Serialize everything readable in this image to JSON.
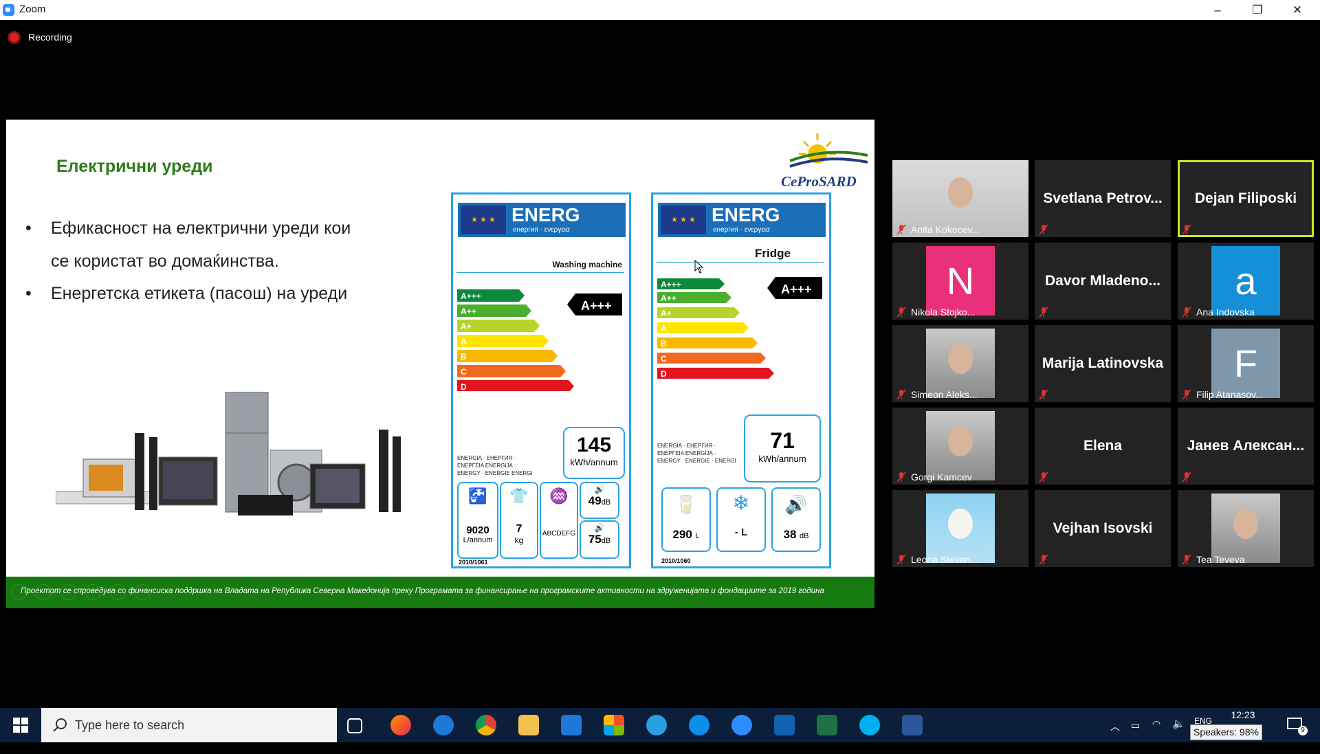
{
  "window": {
    "app_title": "Zoom",
    "minimize": "–",
    "maximize": "❐",
    "close": "✕"
  },
  "recording": {
    "label": "Recording"
  },
  "slide": {
    "title": "Електрични уреди",
    "bullets": [
      "Ефикасност на електрични уреди кои",
      "се користат во домаќинства.",
      "Енергетска етикета (пасош) на уреди"
    ],
    "logo": "CeProSARD",
    "washing_label": {
      "header": "ENERG",
      "subheader": "енергия · ενεργεια",
      "lang_tags": [
        "Y",
        "IJA",
        "IE",
        "IA"
      ],
      "device": "Washing machine",
      "classes": [
        "A+++",
        "A++",
        "A+",
        "A",
        "B",
        "C",
        "D"
      ],
      "rating": "A+++",
      "energy_text": "ENERGIA · ЕНЕРГИЯ · ΕΝΕΡΓΕΙΑ ENERGIJA · ENERGY · ENERGIE ENERGI",
      "kwh_value": "145",
      "kwh_unit": "kWh/annum",
      "water_value": "9020",
      "water_unit": "L/annum",
      "capacity_value": "7",
      "capacity_unit": "kg",
      "spin_class": "ABCDEFG",
      "noise_wash": "49",
      "noise_spin": "75",
      "noise_unit": "dB",
      "regulation": "2010/1061"
    },
    "fridge_label": {
      "header": "ENERG",
      "subheader": "енергия · ενεργεια",
      "lang_tags": [
        "Y",
        "IJA",
        "IE",
        "IA"
      ],
      "device": "Fridge",
      "classes": [
        "A+++",
        "A++",
        "A+",
        "A",
        "B",
        "C",
        "D"
      ],
      "rating": "A+++",
      "energy_text": "ENERGIA · ЕНЕРГИЯ · ΕΝΕΡΓΕΙΑ ENERGIJA · ENERGY · ENERGIE · ENERGI",
      "kwh_value": "71",
      "kwh_unit": "kWh/annum",
      "fresh_value": "290",
      "fresh_unit": "L",
      "freezer_value": "- L",
      "noise_value": "38",
      "noise_unit": "dB",
      "regulation": "2010/1060"
    },
    "footer": "Проектот се спроведува со финансиска поддршка на Владата на Република Северна Македонија преку Програмата за финансирање на програмските активности на здруженијата и фондациите за 2019 година"
  },
  "participants": [
    {
      "name": "Anita Kokocev...",
      "type": "video"
    },
    {
      "name": "Svetlana  Petrov...",
      "type": "name"
    },
    {
      "name": "Dejan Filiposki",
      "type": "name",
      "active": true
    },
    {
      "name": "Nikola Stojko...",
      "type": "letter",
      "letter": "N",
      "color": "#e8317a"
    },
    {
      "name": "Davor  Mladeno...",
      "type": "name"
    },
    {
      "name": "Ana Indovska",
      "type": "letter",
      "letter": "a",
      "color": "#1590d8"
    },
    {
      "name": "Simeon Aleks...",
      "type": "video"
    },
    {
      "name": "Marija Latinovska",
      "type": "name"
    },
    {
      "name": "Filip Atanasov...",
      "type": "letter",
      "letter": "F",
      "color": "#7f97aa"
    },
    {
      "name": "Gorgi Kamcev",
      "type": "video"
    },
    {
      "name": "Elena",
      "type": "name"
    },
    {
      "name": "Јанев  Алексан...",
      "type": "name"
    },
    {
      "name": "Leona Stevan...",
      "type": "video"
    },
    {
      "name": "Vejhan Isovski",
      "type": "name"
    },
    {
      "name": "Tea Teveva",
      "type": "video"
    }
  ],
  "taskbar": {
    "search_placeholder": "Type here to search",
    "clock_time": "12:23",
    "lang": "ENG",
    "speakers": "Speakers: 98%",
    "notifications": "9",
    "pinned": [
      "task-view",
      "firefox",
      "edge-legacy",
      "chrome",
      "file-explorer",
      "mail",
      "store",
      "internet-explorer",
      "teamviewer",
      "zoom",
      "outlook",
      "excel",
      "skype",
      "word"
    ]
  },
  "colors": {
    "slide_green": "#177a10",
    "title_green": "#2e7d1a",
    "label_border": "#2aa4e0",
    "active_speaker": "#c8e62a"
  }
}
